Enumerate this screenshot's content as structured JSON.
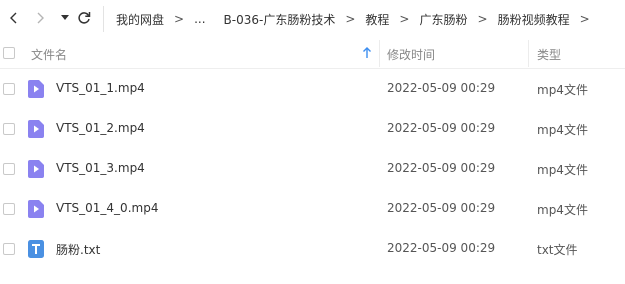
{
  "breadcrumb": {
    "items": [
      "我的网盘",
      "...",
      "B-036-广东肠粉技术",
      "教程",
      "广东肠粉",
      "肠粉视频教程"
    ],
    "separator": ">"
  },
  "header": {
    "name_label": "文件名",
    "mtime_label": "修改时间",
    "type_label": "类型",
    "sort_icon": "sort-ascending-arrow-icon"
  },
  "colors": {
    "video_icon": "#8a82f0",
    "text_icon": "#4a90e2",
    "sort_arrow": "#3b8df0"
  },
  "files": [
    {
      "name": "VTS_01_1.mp4",
      "mtime": "2022-05-09 00:29",
      "type": "mp4文件",
      "icon": "video-file-icon"
    },
    {
      "name": "VTS_01_2.mp4",
      "mtime": "2022-05-09 00:29",
      "type": "mp4文件",
      "icon": "video-file-icon"
    },
    {
      "name": "VTS_01_3.mp4",
      "mtime": "2022-05-09 00:29",
      "type": "mp4文件",
      "icon": "video-file-icon"
    },
    {
      "name": "VTS_01_4_0.mp4",
      "mtime": "2022-05-09 00:29",
      "type": "mp4文件",
      "icon": "video-file-icon"
    },
    {
      "name": "肠粉.txt",
      "mtime": "2022-05-09 00:29",
      "type": "txt文件",
      "icon": "text-file-icon"
    }
  ]
}
